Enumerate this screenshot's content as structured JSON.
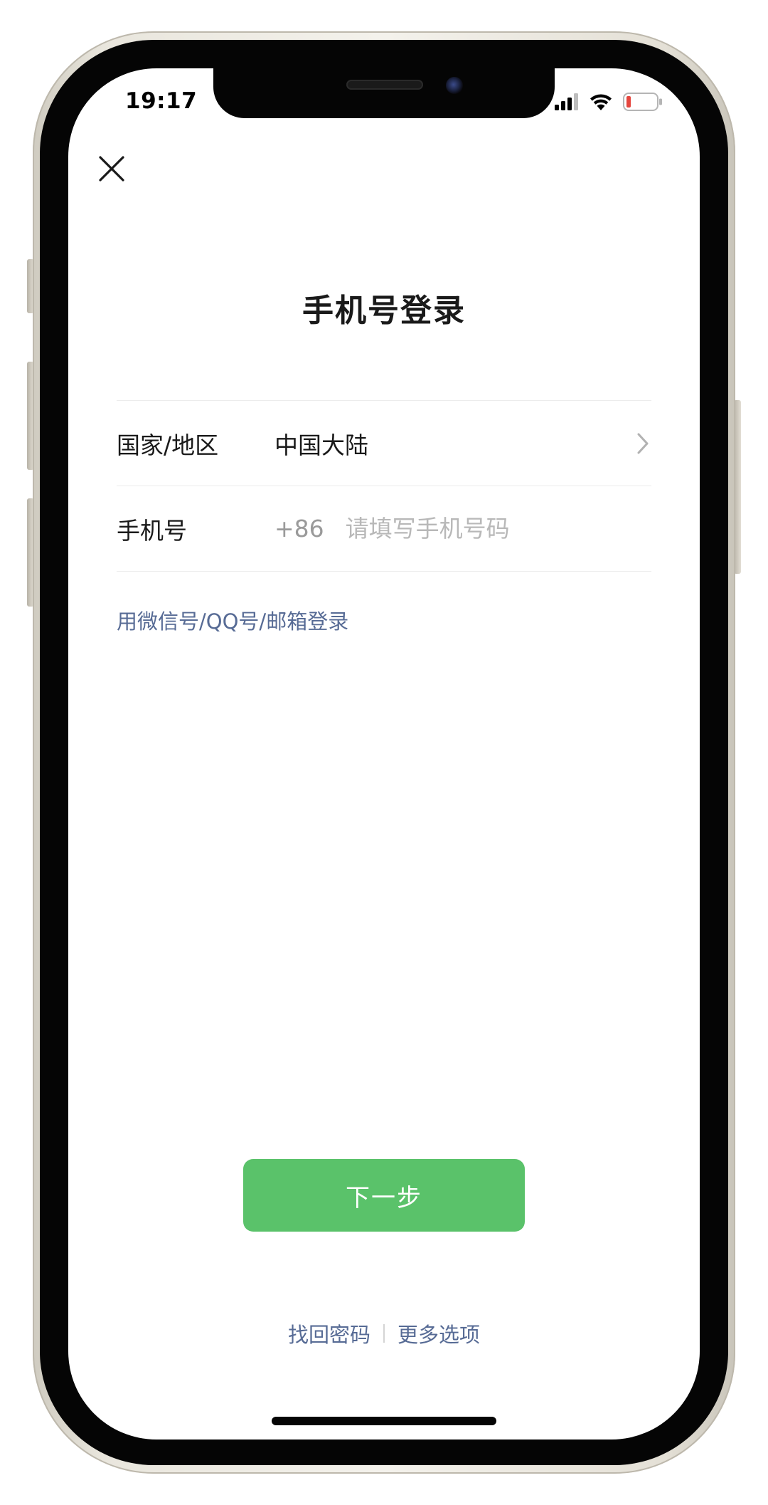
{
  "status_bar": {
    "time": "19:17",
    "battery_color": "#e5463e"
  },
  "header": {
    "close_icon": "close-icon",
    "title": "手机号登录"
  },
  "form": {
    "region_label": "国家/地区",
    "region_value": "中国大陆",
    "phone_label": "手机号",
    "phone_prefix": "+86",
    "phone_placeholder": "请填写手机号码",
    "phone_value": ""
  },
  "links": {
    "alt_login": "用微信号/QQ号/邮箱登录",
    "recover_password": "找回密码",
    "more_options": "更多选项"
  },
  "actions": {
    "next_label": "下一步"
  },
  "colors": {
    "accent": "#5ac26a",
    "link": "#576b95"
  }
}
